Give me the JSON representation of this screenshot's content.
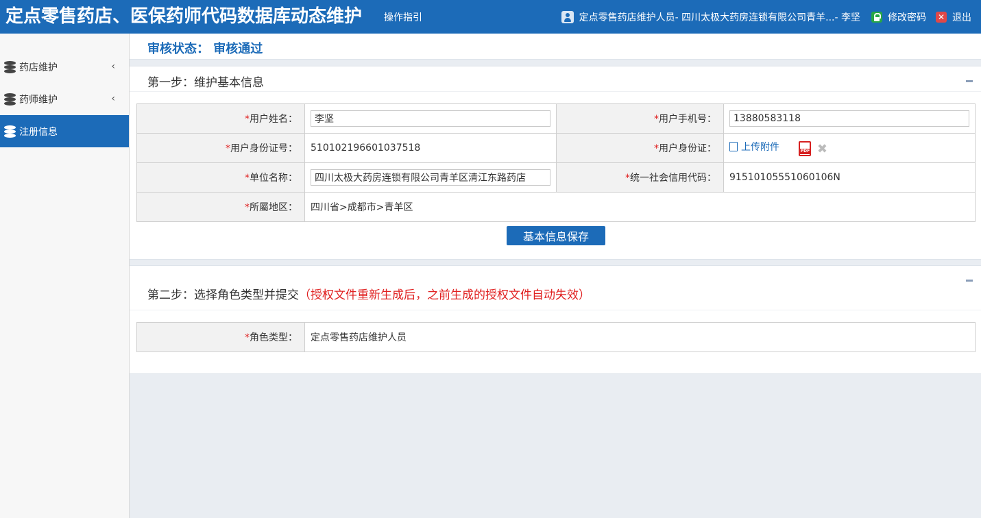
{
  "header": {
    "title": "定点零售药店、医保药师代码数据库动态维护",
    "guide_link": "操作指引",
    "user_info": "定点零售药店维护人员- 四川太极大药房连锁有限公司青羊...- 李坚",
    "change_password": "修改密码",
    "logout": "退出"
  },
  "sidebar": {
    "items": [
      {
        "label": "药店维护",
        "has_chevron": true,
        "active": false
      },
      {
        "label": "药师维护",
        "has_chevron": true,
        "active": false
      },
      {
        "label": "注册信息",
        "has_chevron": false,
        "active": true
      }
    ],
    "chevron": "‹"
  },
  "status": {
    "text": "审核状态： 审核通过"
  },
  "step1": {
    "title": "第一步：维护基本信息",
    "fields": {
      "user_name_label": "用户姓名：",
      "user_name_value": "李坚",
      "phone_label": "用户手机号：",
      "phone_value": "13880583118",
      "id_number_label": "用户身份证号：",
      "id_number_value": "510102196601037518",
      "id_card_label": "用户身份证：",
      "upload_label": "上传附件",
      "unit_name_label": "单位名称：",
      "unit_name_value": "四川太极大药房连锁有限公司青羊区清江东路药店",
      "credit_code_label": "统一社会信用代码：",
      "credit_code_value": "91510105551060106N",
      "region_label": "所屬地区：",
      "region_value": "四川省>成都市>青羊区"
    },
    "save_button": "基本信息保存",
    "required_mark": "*",
    "pdf_badge": "PDF"
  },
  "step2": {
    "title": "第二步：选择角色类型并提交",
    "warning": "（授权文件重新生成后，之前生成的授权文件自动失效）",
    "role_label": "角色类型：",
    "role_value": "定点零售药店维护人员"
  },
  "colors": {
    "primary": "#1c6bb8",
    "required": "#e02020",
    "background": "#e9edf2"
  }
}
